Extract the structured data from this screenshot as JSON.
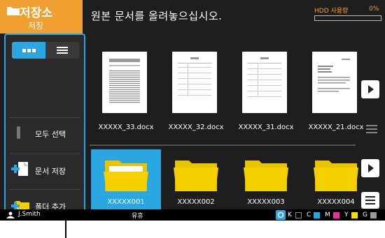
{
  "header": {
    "title": "저장소",
    "subtitle": "저장",
    "instruction": "원본 문서를 올려놓으십시오.",
    "hdd_label": "HDD 사용량",
    "hdd_value": "0%",
    "hdd_fraction": 0
  },
  "sidebar": {
    "view_modes": [
      "thumbnail-view",
      "list-view"
    ],
    "select_all": "모두 선택",
    "save_document": "문서 저장",
    "add_folder": "폴더 추가"
  },
  "documents": [
    {
      "name": "XXXXX_33.docx"
    },
    {
      "name": "XXXXX_32.docx"
    },
    {
      "name": "XXXXX_31.docx"
    },
    {
      "name": "XXXXX_21.docx"
    }
  ],
  "folders": [
    {
      "name": "XXXXX001",
      "selected": true
    },
    {
      "name": "XXXXX002",
      "selected": false
    },
    {
      "name": "XXXXX003",
      "selected": false
    },
    {
      "name": "XXXXX004",
      "selected": false
    }
  ],
  "status": {
    "user": "J.Smith",
    "state": "유휴",
    "inks": [
      {
        "label": "K",
        "color": "#333333"
      },
      {
        "label": "C",
        "color": "#2aa7e0"
      },
      {
        "label": "M",
        "color": "#e0359a"
      },
      {
        "label": "Y",
        "color": "#f2e100"
      },
      {
        "label": "G",
        "color": "#999999"
      }
    ]
  },
  "colors": {
    "accent_orange": "#f0a030",
    "accent_blue": "#2aa7e0",
    "folder_yellow": "#f5d000"
  }
}
